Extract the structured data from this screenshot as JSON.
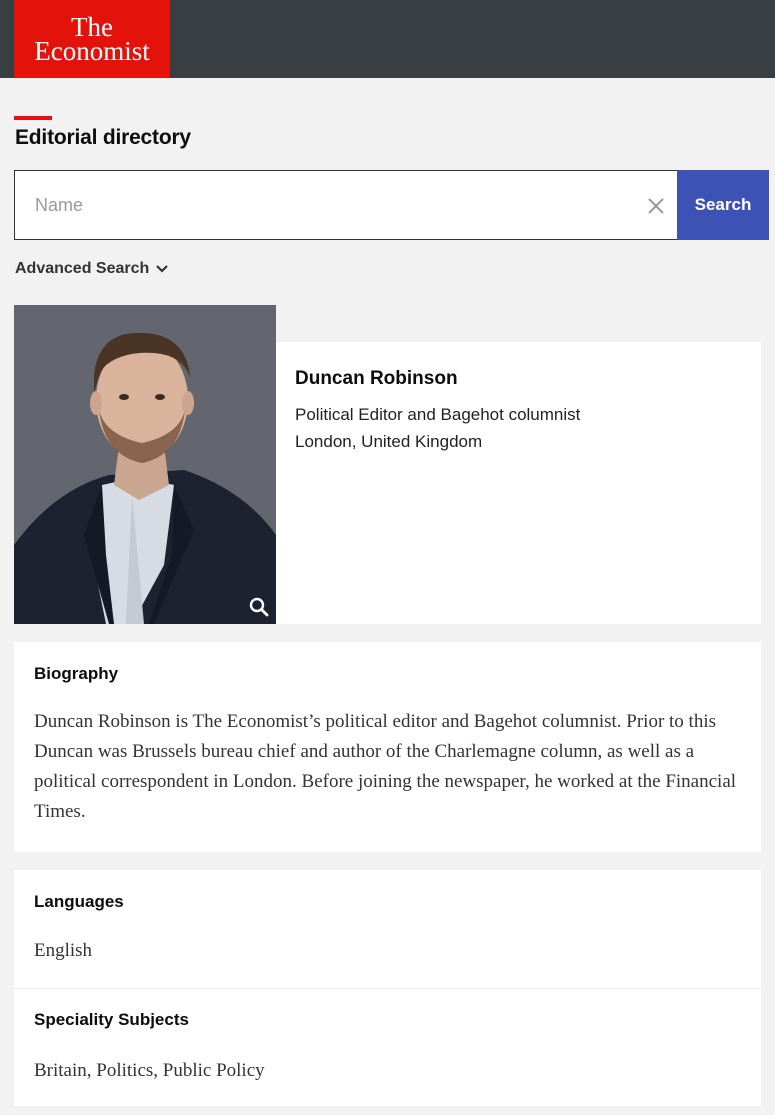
{
  "header": {
    "logo_line1": "The",
    "logo_line2": "Economist"
  },
  "page": {
    "title": "Editorial directory"
  },
  "search": {
    "placeholder": "Name",
    "value": "",
    "button_label": "Search",
    "advanced_label": "Advanced Search"
  },
  "profile": {
    "name": "Duncan Robinson",
    "role": "Political Editor and Bagehot columnist",
    "location": "London, United Kingdom"
  },
  "biography": {
    "heading": "Biography",
    "text": "Duncan Robinson is The Economist’s political editor and Bagehot columnist. Prior to this Duncan was Brussels bureau chief and author of the Charlemagne column, as well as a political correspondent in London. Before joining the newspaper, he worked at the Financial Times."
  },
  "languages": {
    "heading": "Languages",
    "value": "English"
  },
  "subjects": {
    "heading": "Speciality Subjects",
    "value": "Britain, Politics, Public Policy"
  },
  "colors": {
    "brand_red": "#e3120b",
    "header_bg": "#383e42",
    "search_button": "#3c52b5"
  }
}
